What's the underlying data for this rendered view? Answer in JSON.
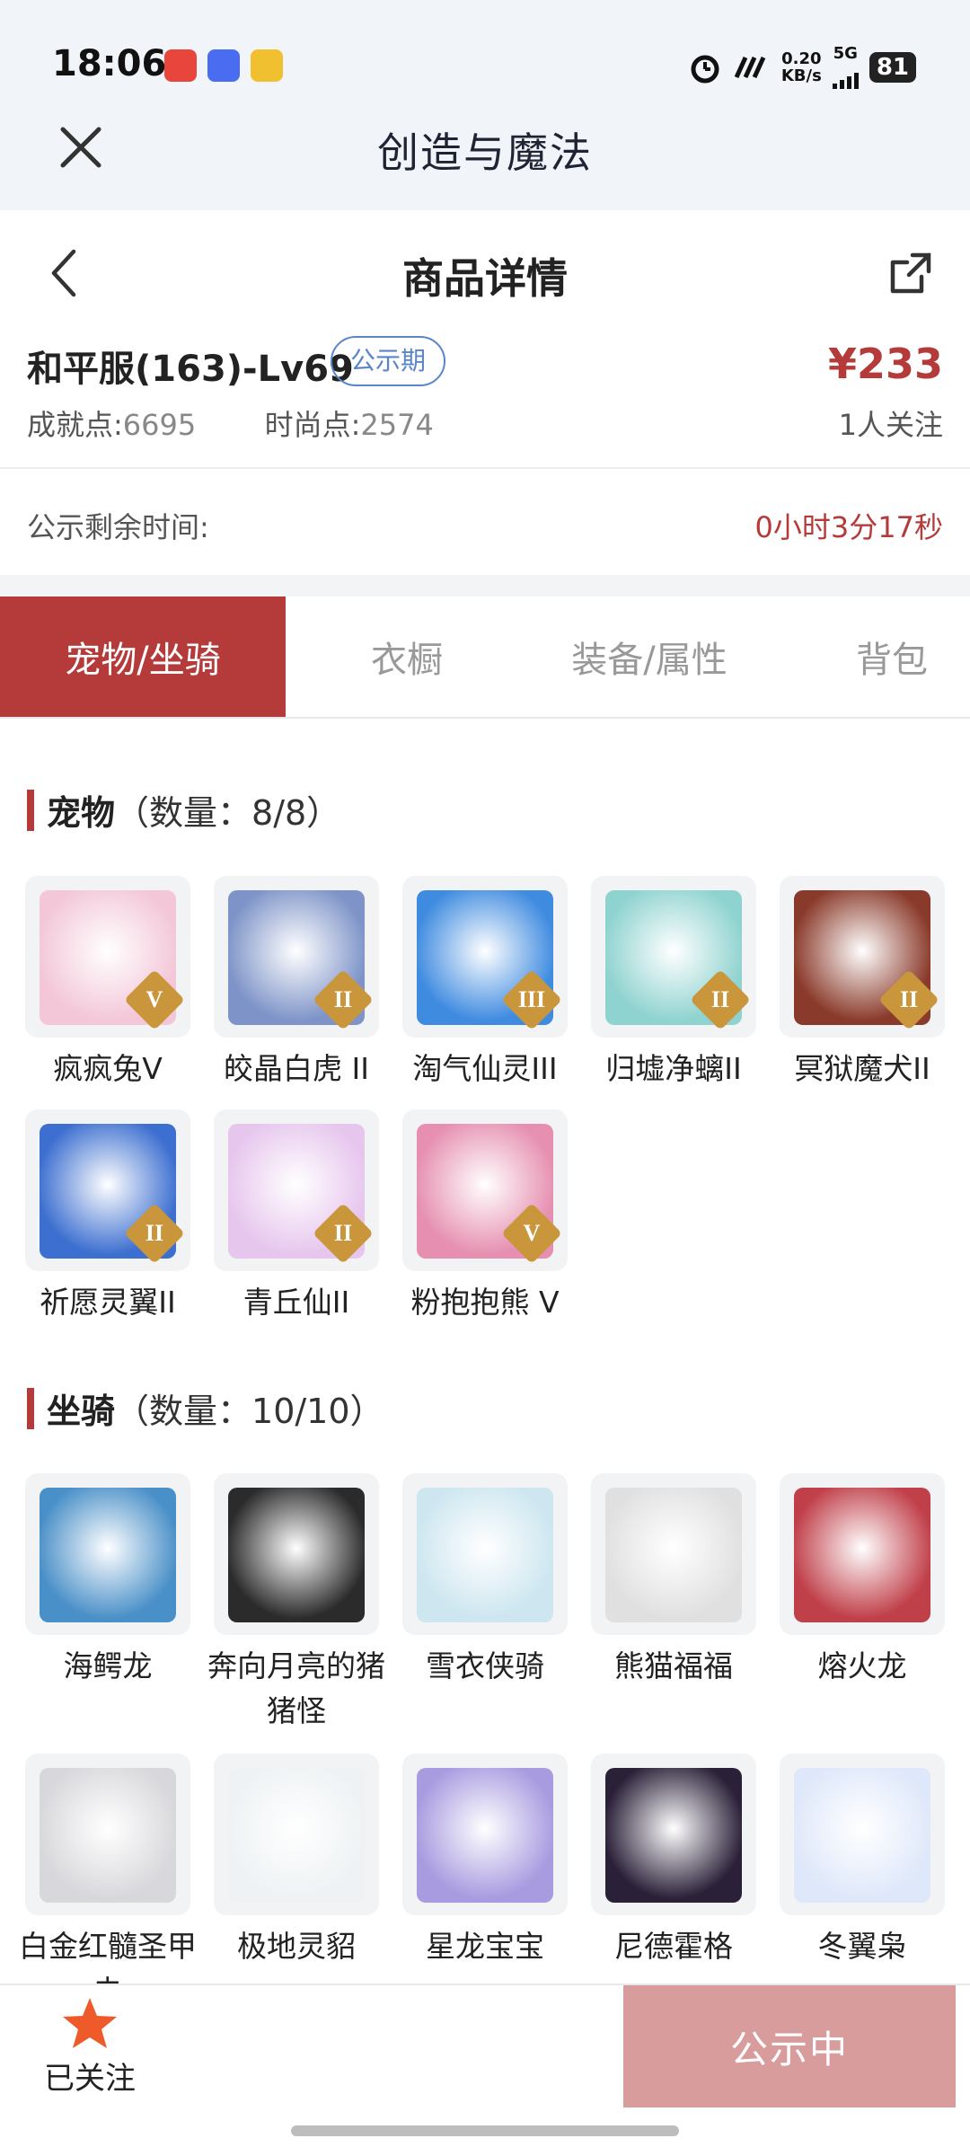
{
  "status_bar": {
    "time": "18:06",
    "net_speed_value": "0.20",
    "net_speed_unit": "KB/s",
    "network": "5G",
    "battery": "81",
    "app_icon_colors": [
      "#e8463c",
      "#4a6cf0",
      "#f0c030"
    ]
  },
  "app": {
    "title": "创造与魔法",
    "close_icon": "close-icon"
  },
  "page": {
    "title": "商品详情",
    "back_icon": "chevron-left-icon",
    "share_icon": "share-icon"
  },
  "product": {
    "server": "和平服(163)-Lv69",
    "badge": "公示期",
    "price": "¥233",
    "achievement_label": "成就点:",
    "achievement_value": "6695",
    "fashion_label": "时尚点:",
    "fashion_value": "2574",
    "followers": "1人关注"
  },
  "countdown": {
    "label": "公示剩余时间:",
    "value": "0小时3分17秒"
  },
  "tabs": [
    {
      "label": "宠物/坐骑",
      "active": true
    },
    {
      "label": "衣橱",
      "active": false
    },
    {
      "label": "装备/属性",
      "active": false
    },
    {
      "label": "背包",
      "active": false
    }
  ],
  "pets": {
    "title": "宠物",
    "count": "（数量：8/8）",
    "items": [
      {
        "name": "疯疯兔V",
        "rank": "V",
        "color": "#f3c7d8"
      },
      {
        "name": "皎晶白虎 II",
        "rank": "II",
        "color": "#7e94c8"
      },
      {
        "name": "淘气仙灵III",
        "rank": "III",
        "color": "#3f8be0"
      },
      {
        "name": "归墟净螭II",
        "rank": "II",
        "color": "#8fd3d0"
      },
      {
        "name": "冥狱魔犬II",
        "rank": "II",
        "color": "#8a3a2a"
      },
      {
        "name": "祈愿灵翼II",
        "rank": "II",
        "color": "#3d6fd0"
      },
      {
        "name": "青丘仙II",
        "rank": "II",
        "color": "#e7c6ee"
      },
      {
        "name": "粉抱抱熊 V",
        "rank": "V",
        "color": "#e68fb0"
      }
    ]
  },
  "mounts": {
    "title": "坐骑",
    "count": "（数量：10/10）",
    "items": [
      {
        "name": "海鳄龙",
        "color": "#4a90c8"
      },
      {
        "name": "奔向月亮的猪猪怪",
        "color": "#2b2b2b"
      },
      {
        "name": "雪衣侠骑",
        "color": "#cde6f0"
      },
      {
        "name": "熊猫福福",
        "color": "#e0e0e0"
      },
      {
        "name": "熔火龙",
        "color": "#c0404a"
      },
      {
        "name": "白金红髓圣甲虫",
        "color": "#d8d8dc"
      },
      {
        "name": "极地灵貂",
        "color": "#eef2f4"
      },
      {
        "name": "星龙宝宝",
        "color": "#a89be0"
      },
      {
        "name": "尼德霍格",
        "color": "#2a2038"
      },
      {
        "name": "冬翼枭",
        "color": "#dfe8fa"
      }
    ]
  },
  "bottom": {
    "follow_label": "已关注",
    "status_label": "公示中",
    "accent": "#b53a3a",
    "star_color": "#ef5a2a"
  }
}
